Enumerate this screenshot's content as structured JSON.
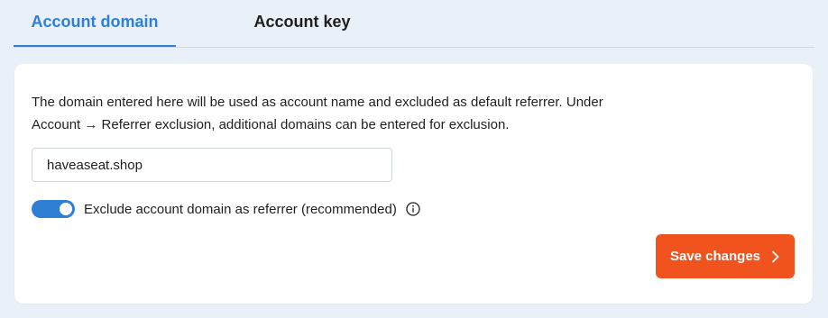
{
  "tabs": {
    "active_label": "Account domain",
    "inactive_label": "Account key"
  },
  "card": {
    "description_line1": "The domain entered here will be used as account name and excluded as default referrer. Under",
    "description_line2": "Account → Referrer exclusion, additional domains can be entered for exclusion.",
    "domain_value": "haveaseat.shop",
    "toggle_label": "Exclude account domain as referrer (recommended)",
    "toggle_on": true,
    "info_icon": "info-icon",
    "save_label": "Save changes",
    "save_icon": "chevron-right-icon"
  },
  "colors": {
    "accent": "#2f7fd6",
    "save_button": "#f0531e",
    "background": "#eaf0f7"
  }
}
